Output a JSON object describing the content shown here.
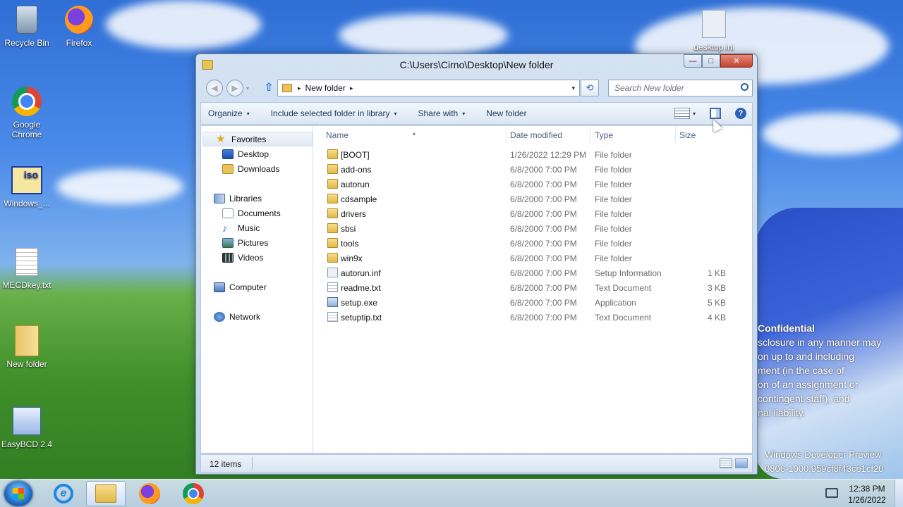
{
  "desktop": {
    "icons": [
      {
        "label": "Recycle Bin",
        "icon": "recycle-bin-icon"
      },
      {
        "label": "Firefox",
        "icon": "firefox-icon"
      },
      {
        "label": "Google Chrome",
        "icon": "chrome-icon"
      },
      {
        "label": "Windows_...",
        "icon": "iso-file-icon",
        "badge": "iso"
      },
      {
        "label": "MECDkey.txt",
        "icon": "text-file-icon"
      },
      {
        "label": "New folder",
        "icon": "folder-icon"
      },
      {
        "label": "EasyBCD 2.4",
        "icon": "easybcd-icon"
      },
      {
        "label": "desktop.ini",
        "icon": "ini-file-icon"
      }
    ],
    "watermark": {
      "heading": "Confidential",
      "lines": [
        "sclosure in any manner may",
        "on up to and including",
        "ment (in the case of",
        "on of an assignment or",
        "contingent staff), and",
        "nal liability."
      ],
      "build_line1": "Windows Developer Preview",
      "build_line2": "0806-1000.959cf8f43ce1cf20"
    }
  },
  "window": {
    "title": "C:\\Users\\Cirno\\Desktop\\New folder",
    "caption_buttons": {
      "minimize": "—",
      "maximize": "□",
      "close": "✕"
    },
    "address": {
      "segment": "New folder",
      "separator": "▸",
      "dropdown": "▾"
    },
    "search": {
      "placeholder": "Search New folder"
    },
    "toolbar": {
      "organize": "Organize",
      "include": "Include selected folder in library",
      "share": "Share with",
      "new_folder": "New folder",
      "caret": "▾",
      "help": "?"
    },
    "nav": {
      "favorites": "Favorites",
      "desktop": "Desktop",
      "downloads": "Downloads",
      "libraries": "Libraries",
      "documents": "Documents",
      "music": "Music",
      "pictures": "Pictures",
      "videos": "Videos",
      "computer": "Computer",
      "network": "Network"
    },
    "columns": {
      "name": "Name",
      "date": "Date modified",
      "type": "Type",
      "size": "Size"
    },
    "files": [
      {
        "name": "[BOOT]",
        "date": "1/26/2022 12:29 PM",
        "type": "File folder",
        "size": "",
        "kind": "folder"
      },
      {
        "name": "add-ons",
        "date": "6/8/2000 7:00 PM",
        "type": "File folder",
        "size": "",
        "kind": "folder"
      },
      {
        "name": "autorun",
        "date": "6/8/2000 7:00 PM",
        "type": "File folder",
        "size": "",
        "kind": "folder"
      },
      {
        "name": "cdsample",
        "date": "6/8/2000 7:00 PM",
        "type": "File folder",
        "size": "",
        "kind": "folder"
      },
      {
        "name": "drivers",
        "date": "6/8/2000 7:00 PM",
        "type": "File folder",
        "size": "",
        "kind": "folder"
      },
      {
        "name": "sbsi",
        "date": "6/8/2000 7:00 PM",
        "type": "File folder",
        "size": "",
        "kind": "folder"
      },
      {
        "name": "tools",
        "date": "6/8/2000 7:00 PM",
        "type": "File folder",
        "size": "",
        "kind": "folder"
      },
      {
        "name": "win9x",
        "date": "6/8/2000 7:00 PM",
        "type": "File folder",
        "size": "",
        "kind": "folder"
      },
      {
        "name": "autorun.inf",
        "date": "6/8/2000 7:00 PM",
        "type": "Setup Information",
        "size": "1 KB",
        "kind": "inf"
      },
      {
        "name": "readme.txt",
        "date": "6/8/2000 7:00 PM",
        "type": "Text Document",
        "size": "3 KB",
        "kind": "txt"
      },
      {
        "name": "setup.exe",
        "date": "6/8/2000 7:00 PM",
        "type": "Application",
        "size": "5 KB",
        "kind": "exe"
      },
      {
        "name": "setuptip.txt",
        "date": "6/8/2000 7:00 PM",
        "type": "Text Document",
        "size": "4 KB",
        "kind": "txt"
      }
    ],
    "status": {
      "item_count": "12 items"
    }
  },
  "taskbar": {
    "pinned": [
      {
        "name": "internet-explorer",
        "icon": "ie-icon"
      },
      {
        "name": "windows-explorer",
        "icon": "explorer-icon",
        "active": true
      },
      {
        "name": "firefox",
        "icon": "firefox-icon"
      },
      {
        "name": "chrome",
        "icon": "chrome-icon"
      }
    ],
    "ie_glyph": "e",
    "clock": {
      "time": "12:38 PM",
      "date": "1/26/2022"
    }
  }
}
